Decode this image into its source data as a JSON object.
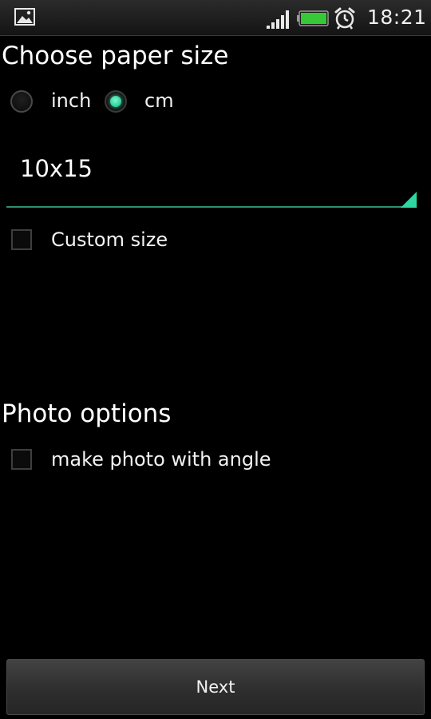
{
  "status_bar": {
    "time": "18:21",
    "icons": [
      "gallery-icon",
      "signal-icon",
      "battery-icon",
      "alarm-icon"
    ],
    "battery_color": "#37c837"
  },
  "paper_section": {
    "title": "Choose paper size",
    "units": [
      {
        "label": "inch",
        "selected": false
      },
      {
        "label": "cm",
        "selected": true
      }
    ],
    "size_value": "10x15",
    "custom_size_label": "Custom size",
    "custom_size_checked": false
  },
  "photo_section": {
    "title": "Photo options",
    "angle_label": "make photo with angle",
    "angle_checked": false
  },
  "footer": {
    "next_label": "Next"
  },
  "colors": {
    "accent": "#2fd69f",
    "background": "#000000"
  }
}
